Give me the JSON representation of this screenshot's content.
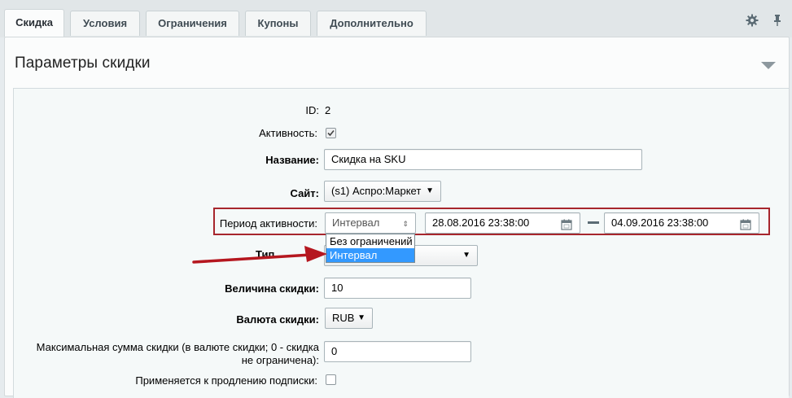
{
  "tabs": [
    {
      "label": "Скидка",
      "active": true
    },
    {
      "label": "Условия",
      "active": false
    },
    {
      "label": "Ограничения",
      "active": false
    },
    {
      "label": "Купоны",
      "active": false
    },
    {
      "label": "Дополнительно",
      "active": false
    }
  ],
  "toolbar": {
    "settings_icon": "gear-icon",
    "pin_icon": "pin-icon"
  },
  "section": {
    "title": "Параметры скидки"
  },
  "form": {
    "id_label": "ID:",
    "id_value": "2",
    "active_label": "Активность:",
    "active_checked": true,
    "name_label": "Название:",
    "name_value": "Скидка на SKU",
    "site_label": "Сайт:",
    "site_value": "(s1) Аспро:Маркет",
    "period_label": "Период активности:",
    "period_value": "Интервал",
    "period_from": "28.08.2016 23:38:00",
    "period_to": "04.09.2016 23:38:00",
    "period_options": [
      "Без ограничений",
      "Интервал"
    ],
    "period_selected": "Интервал",
    "type_label": "Тип скидки:",
    "type_label_visible": "Тип",
    "amount_label": "Величина скидки:",
    "amount_value": "10",
    "currency_label": "Валюта скидки:",
    "currency_value": "RUB",
    "max_label_line1": "Максимальная сумма скидки (в валюте скидки; 0 - скидка",
    "max_label_line2": "не ограничена):",
    "max_value": "0",
    "renew_label": "Применяется к продлению подписки:",
    "renew_checked": false
  },
  "colors": {
    "highlight": "#a7262d",
    "arrow": "#b5171f",
    "selected_option": "#3399ff"
  }
}
